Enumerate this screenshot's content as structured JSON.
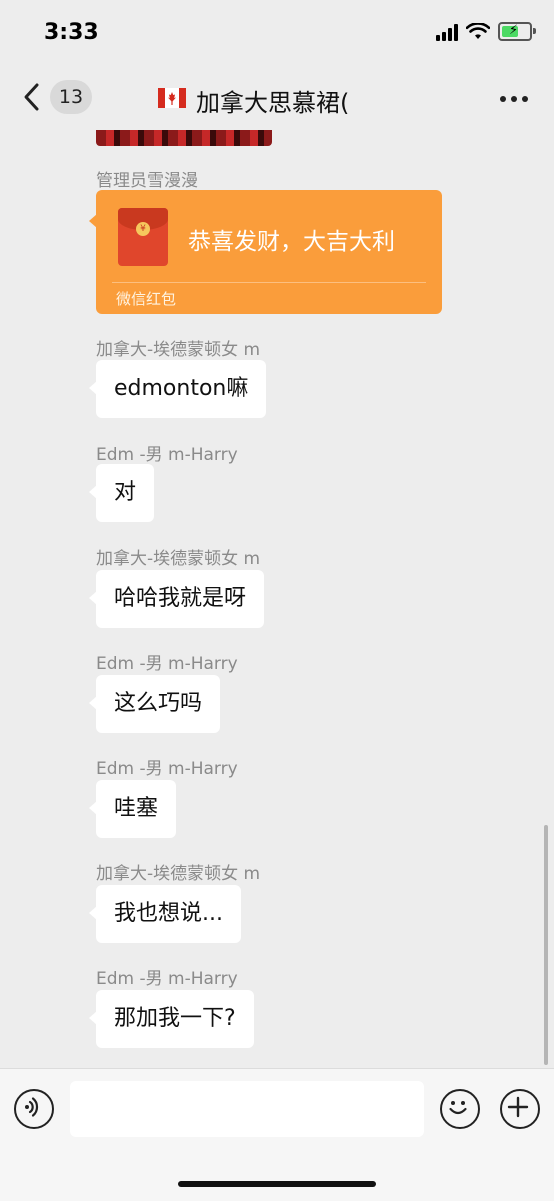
{
  "status_bar": {
    "time": "3:33"
  },
  "nav": {
    "unread_count": "13",
    "title": "加拿大思慕裙("
  },
  "messages": [
    {
      "type": "red_packet",
      "sender": "管理员雪漫漫",
      "greeting": "恭喜发财，大吉大利",
      "label": "微信红包"
    },
    {
      "type": "text",
      "sender": "加拿大-埃德蒙顿女 m",
      "text": "edmonton嘛"
    },
    {
      "type": "text",
      "sender": "Edm -男 m-Harry",
      "text": "对"
    },
    {
      "type": "text",
      "sender": "加拿大-埃德蒙顿女 m",
      "text": "哈哈我就是呀"
    },
    {
      "type": "text",
      "sender": "Edm -男 m-Harry",
      "text": "这么巧吗"
    },
    {
      "type": "text",
      "sender": "Edm -男 m-Harry",
      "text": "哇塞"
    },
    {
      "type": "text",
      "sender": "加拿大-埃德蒙顿女 m",
      "text": "我也想说..."
    },
    {
      "type": "text",
      "sender": "Edm -男 m-Harry",
      "text": "那加我一下?"
    }
  ],
  "input": {
    "value": ""
  },
  "colors": {
    "background": "#ededed",
    "red_packet": "#fa9d3b",
    "bubble": "#ffffff"
  }
}
